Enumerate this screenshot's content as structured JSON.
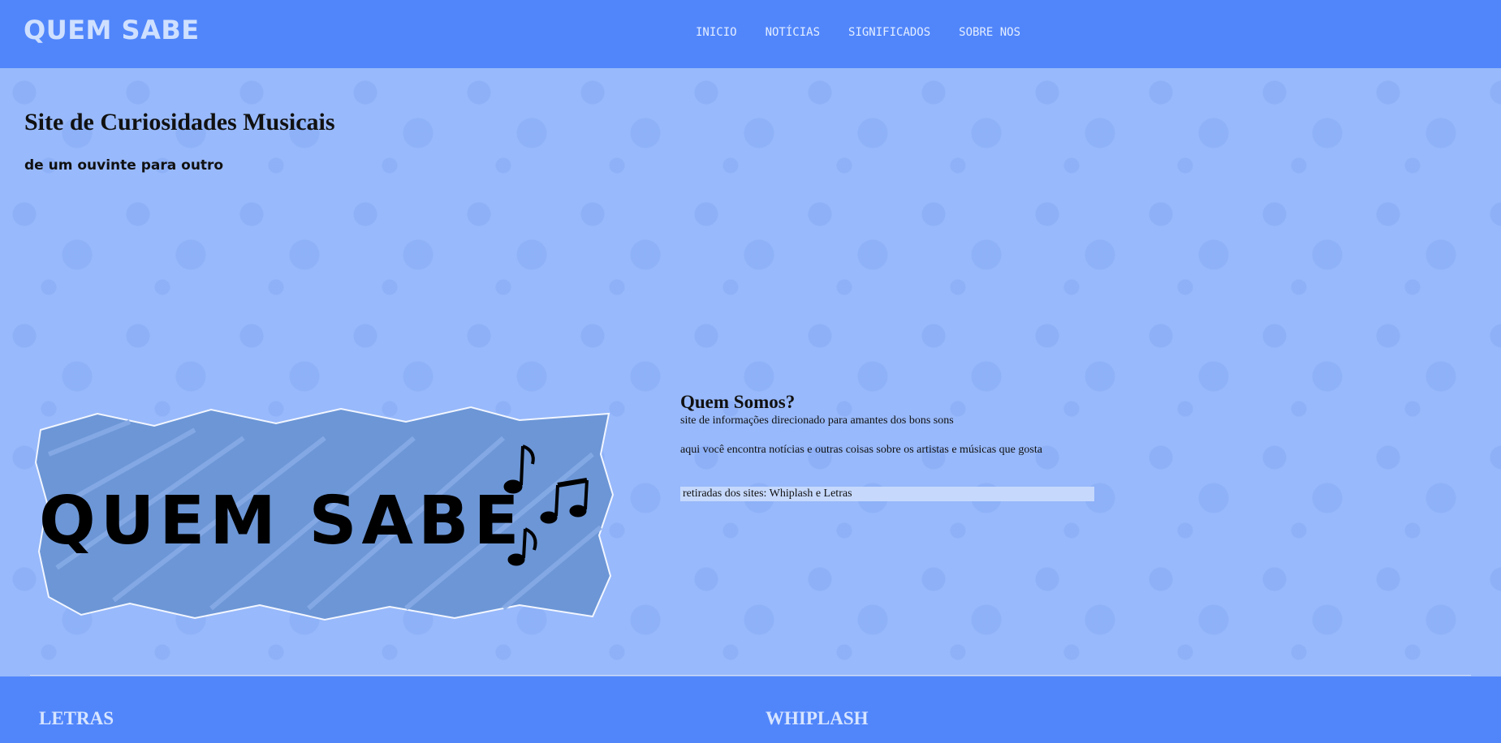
{
  "header": {
    "brand": "QUEM SABE",
    "nav": [
      "INICIO",
      "NOTÍCIAS",
      "SIGNIFICADOS",
      "SOBRE NOS"
    ]
  },
  "hero": {
    "title": "Site de Curiosidades Musicais",
    "subtitle": "de um ouvinte para outro"
  },
  "logo": {
    "text": "QUEM SABE",
    "accent_color": "#6c96d6"
  },
  "about": {
    "heading": "Quem Somos?",
    "line1": "site de informações direcionado para amantes dos bons sons",
    "line2": "aqui você encontra notícias e outras coisas sobre os artistas e músicas que gosta",
    "sources": "retiradas dos sites: Whiplash e Letras"
  },
  "footer": {
    "col1": "LETRAS",
    "col2": "WHIPLASH"
  },
  "colors": {
    "header": "#5186fb",
    "background": "#98b9fb"
  }
}
